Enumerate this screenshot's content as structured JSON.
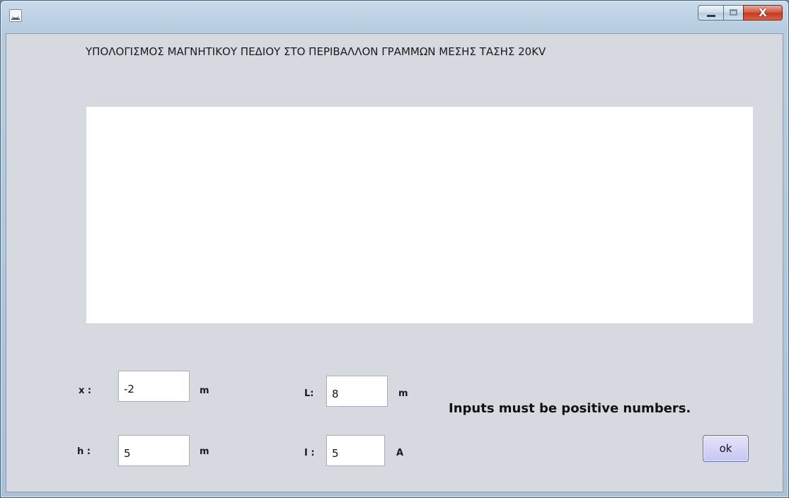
{
  "window": {
    "title": ""
  },
  "heading": "ΥΠΟΛΟΓΙΣΜΟΣ ΜΑΓΝΗΤΙΚΟΥ ΠΕΔΙΟΥ ΣΤΟ ΠΕΡΙΒΑΛΛΟΝ ΓΡΑΜΜΩΝ ΜΕΣΗΣ ΤΑΣΗΣ 20KV",
  "output": {
    "text": ""
  },
  "inputs": {
    "x": {
      "label": "x :",
      "value": "-2",
      "unit": "m"
    },
    "h": {
      "label": "h :",
      "value": "5",
      "unit": "m"
    },
    "L": {
      "label": "L:",
      "value": "8",
      "unit": "m"
    },
    "I": {
      "label": "I :",
      "value": "5",
      "unit": "A"
    }
  },
  "message": "Inputs must be positive numbers.",
  "ok_button": {
    "label": "ok"
  },
  "icons": {
    "app": "java-app-icon",
    "minimize": "minimize-icon",
    "maximize": "maximize-icon",
    "close": "close-icon"
  }
}
